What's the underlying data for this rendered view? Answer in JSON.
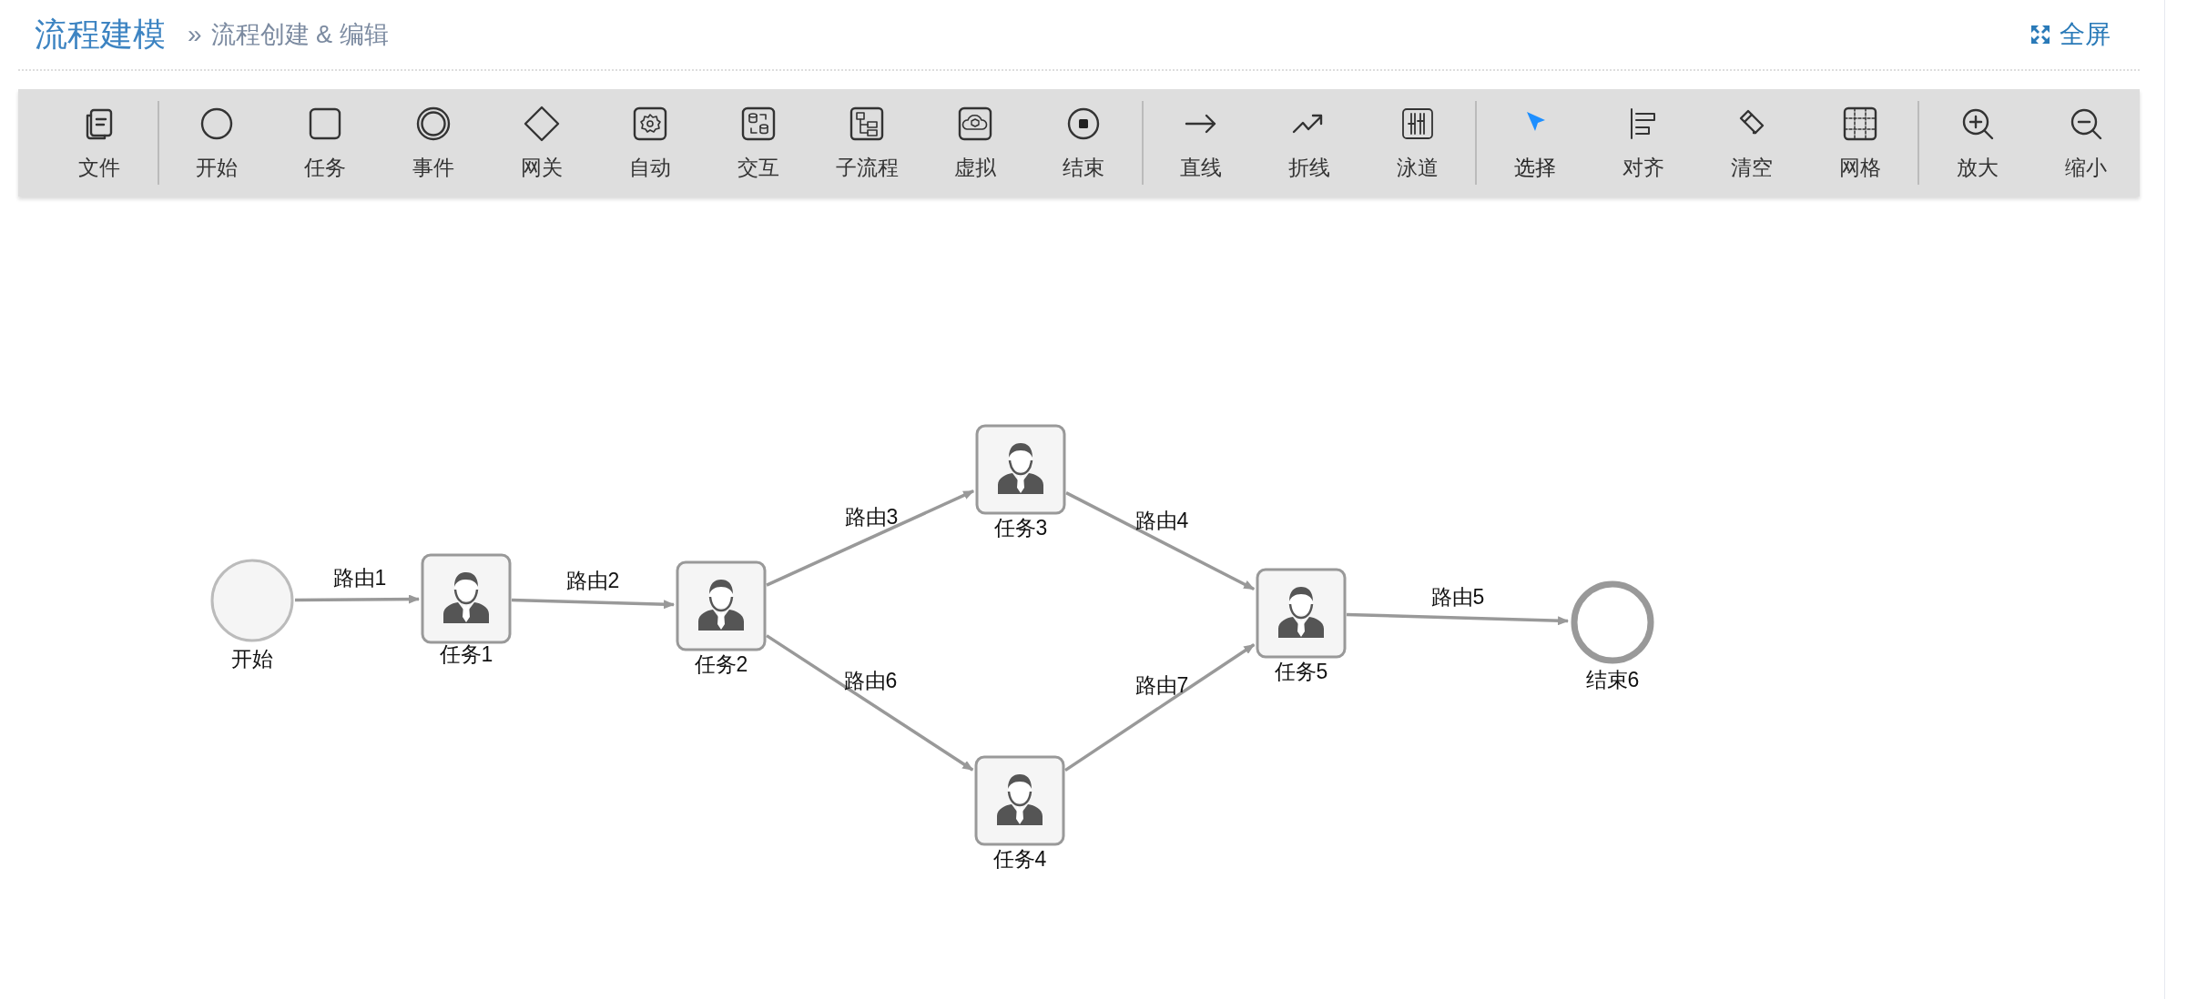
{
  "header": {
    "title": "流程建模",
    "breadcrumb_separator": "»",
    "breadcrumb": "流程创建 & 编辑",
    "fullscreen": "全屏"
  },
  "toolbar": [
    [
      {
        "label": "文件",
        "selected": false
      }
    ],
    [
      {
        "label": "开始",
        "selected": false
      },
      {
        "label": "任务",
        "selected": false
      },
      {
        "label": "事件",
        "selected": false
      },
      {
        "label": "网关",
        "selected": false
      },
      {
        "label": "自动",
        "selected": false
      },
      {
        "label": "交互",
        "selected": false
      },
      {
        "label": "子流程",
        "selected": false
      },
      {
        "label": "虚拟",
        "selected": false
      },
      {
        "label": "结束",
        "selected": false
      }
    ],
    [
      {
        "label": "直线",
        "selected": false
      },
      {
        "label": "折线",
        "selected": false
      },
      {
        "label": "泳道",
        "selected": false
      }
    ],
    [
      {
        "label": "选择",
        "selected": true
      },
      {
        "label": "对齐",
        "selected": false
      },
      {
        "label": "清空",
        "selected": false
      },
      {
        "label": "网格",
        "selected": false
      }
    ],
    [
      {
        "label": "放大",
        "selected": false
      },
      {
        "label": "缩小",
        "selected": false
      }
    ]
  ],
  "diagram": {
    "nodes": [
      {
        "kind": "start",
        "label": "开始"
      },
      {
        "kind": "task",
        "label": "任务1"
      },
      {
        "kind": "task",
        "label": "任务2"
      },
      {
        "kind": "task",
        "label": "任务3"
      },
      {
        "kind": "task",
        "label": "任务4"
      },
      {
        "kind": "task",
        "label": "任务5"
      },
      {
        "kind": "end",
        "label": "结束6"
      }
    ],
    "routes": [
      {
        "label": "路由1"
      },
      {
        "label": "路由2"
      },
      {
        "label": "路由3"
      },
      {
        "label": "路由4"
      },
      {
        "label": "路由5"
      },
      {
        "label": "路由6"
      },
      {
        "label": "路由7"
      }
    ]
  }
}
